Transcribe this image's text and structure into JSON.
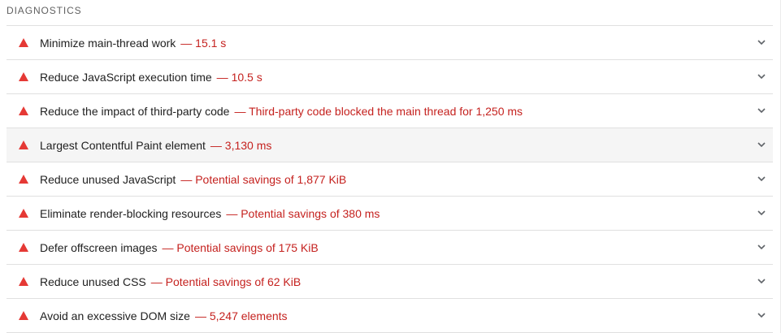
{
  "section": {
    "title": "DIAGNOSTICS"
  },
  "colors": {
    "fail": "#e53935",
    "value_text": "#c5221f",
    "title_text": "#212121",
    "header_text": "#616161",
    "divider": "#e0e0e0",
    "highlight_row": "#f5f5f5"
  },
  "audits": [
    {
      "title": "Minimize main-thread work",
      "separator": "—",
      "value": "15.1 s",
      "status": "fail",
      "icon": "red-triangle-icon",
      "expand_icon": "chevron-down-icon"
    },
    {
      "title": "Reduce JavaScript execution time",
      "separator": "—",
      "value": "10.5 s",
      "status": "fail",
      "icon": "red-triangle-icon",
      "expand_icon": "chevron-down-icon"
    },
    {
      "title": "Reduce the impact of third-party code",
      "separator": "—",
      "value": "Third-party code blocked the main thread for 1,250 ms",
      "status": "fail",
      "icon": "red-triangle-icon",
      "expand_icon": "chevron-down-icon"
    },
    {
      "title": "Largest Contentful Paint element",
      "separator": "—",
      "value": "3,130 ms",
      "status": "fail",
      "icon": "red-triangle-icon",
      "expand_icon": "chevron-down-icon",
      "hovered": true
    },
    {
      "title": "Reduce unused JavaScript",
      "separator": "—",
      "value": "Potential savings of 1,877 KiB",
      "status": "fail",
      "icon": "red-triangle-icon",
      "expand_icon": "chevron-down-icon"
    },
    {
      "title": "Eliminate render-blocking resources",
      "separator": "—",
      "value": "Potential savings of 380 ms",
      "status": "fail",
      "icon": "red-triangle-icon",
      "expand_icon": "chevron-down-icon"
    },
    {
      "title": "Defer offscreen images",
      "separator": "—",
      "value": "Potential savings of 175 KiB",
      "status": "fail",
      "icon": "red-triangle-icon",
      "expand_icon": "chevron-down-icon"
    },
    {
      "title": "Reduce unused CSS",
      "separator": "—",
      "value": "Potential savings of 62 KiB",
      "status": "fail",
      "icon": "red-triangle-icon",
      "expand_icon": "chevron-down-icon"
    },
    {
      "title": "Avoid an excessive DOM size",
      "separator": "—",
      "value": "5,247 elements",
      "status": "fail",
      "icon": "red-triangle-icon",
      "expand_icon": "chevron-down-icon"
    }
  ]
}
